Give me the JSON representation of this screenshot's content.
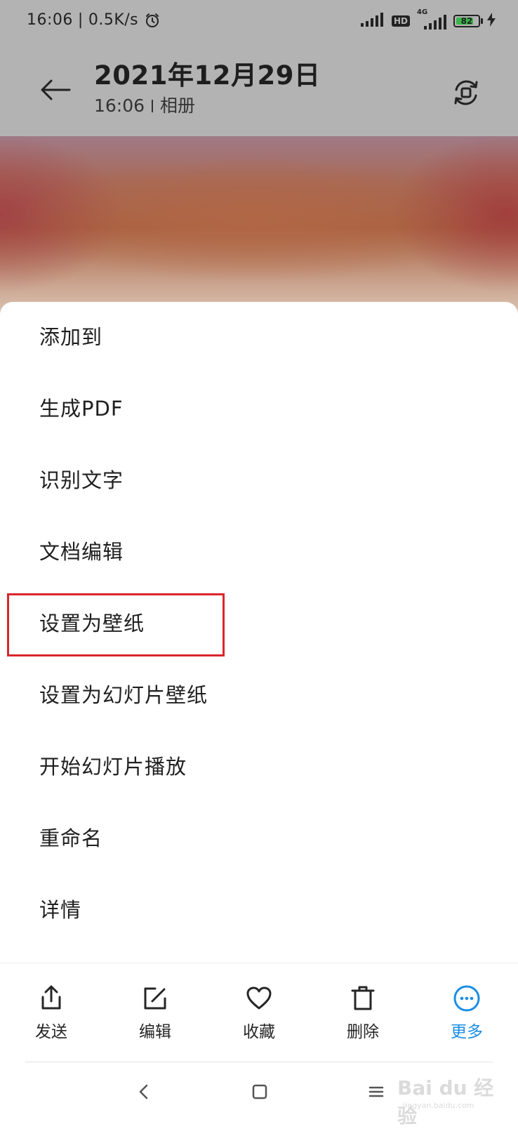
{
  "status_bar": {
    "time": "16:06",
    "speed": "0.5K/s",
    "hd": "HD",
    "network": "4G",
    "battery": "82",
    "battery_level": 0.82
  },
  "header": {
    "title": "2021年12月29日",
    "time": "16:06",
    "album": "相册"
  },
  "menu": {
    "items": [
      {
        "label": "添加到"
      },
      {
        "label": "生成PDF"
      },
      {
        "label": "识别文字"
      },
      {
        "label": "文档编辑"
      },
      {
        "label": "设置为壁纸",
        "highlighted": true
      },
      {
        "label": "设置为幻灯片壁纸"
      },
      {
        "label": "开始幻灯片播放"
      },
      {
        "label": "重命名"
      },
      {
        "label": "详情"
      }
    ]
  },
  "toolbar": {
    "items": [
      {
        "label": "发送",
        "icon": "share-icon"
      },
      {
        "label": "编辑",
        "icon": "edit-icon"
      },
      {
        "label": "收藏",
        "icon": "heart-icon"
      },
      {
        "label": "删除",
        "icon": "trash-icon"
      },
      {
        "label": "更多",
        "icon": "more-icon",
        "active": true
      }
    ]
  },
  "colors": {
    "accent": "#1a8ee6",
    "highlight": "#d9262c",
    "battery_fill": "#39b54a"
  },
  "watermark": {
    "text": "Bai du 经验",
    "sub": "jingyan.baidu.com"
  }
}
